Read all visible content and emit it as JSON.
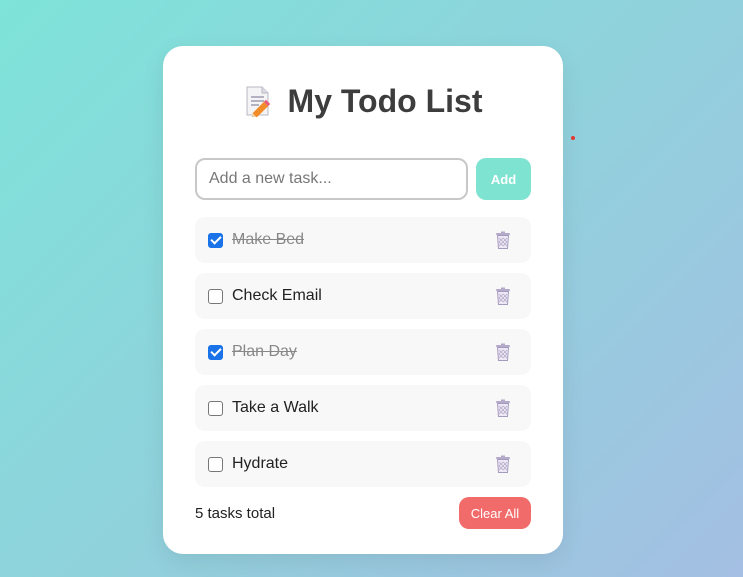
{
  "header": {
    "title": "My Todo List",
    "icon": "memo-pencil-icon"
  },
  "input": {
    "placeholder": "Add a new task...",
    "value": ""
  },
  "add_button": {
    "label": "Add"
  },
  "todos": [
    {
      "text": "Make Bed",
      "completed": true
    },
    {
      "text": "Check Email",
      "completed": false
    },
    {
      "text": "Plan Day",
      "completed": true
    },
    {
      "text": "Take a Walk",
      "completed": false
    },
    {
      "text": "Hydrate",
      "completed": false
    }
  ],
  "footer": {
    "total_text": "5 tasks total",
    "clear_label": "Clear All"
  },
  "colors": {
    "add_button": "#7fe3d2",
    "clear_button": "#f26b6b",
    "checkbox_checked": "#1a73e8",
    "background_start": "#7ee3d9",
    "background_end": "#a4bfe3"
  }
}
